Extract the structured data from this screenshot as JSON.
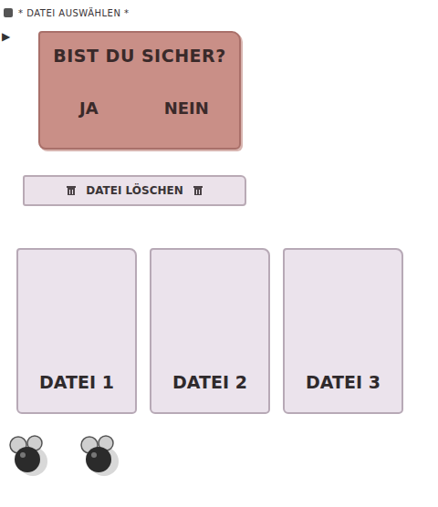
{
  "header": {
    "title": "* DATEI AUSWÄHLEN *",
    "cursor": "▶"
  },
  "dialog": {
    "question": "BIST DU SICHER?",
    "buttons": [
      {
        "label": "JA",
        "selected": false
      },
      {
        "label": "NEIN",
        "selected": false
      }
    ]
  },
  "delete_button": {
    "label": "DATEI LÖSCHEN"
  },
  "files": [
    {
      "label": "DATEI 1"
    },
    {
      "label": "DATEI 2"
    },
    {
      "label": "DATEI 3"
    }
  ]
}
